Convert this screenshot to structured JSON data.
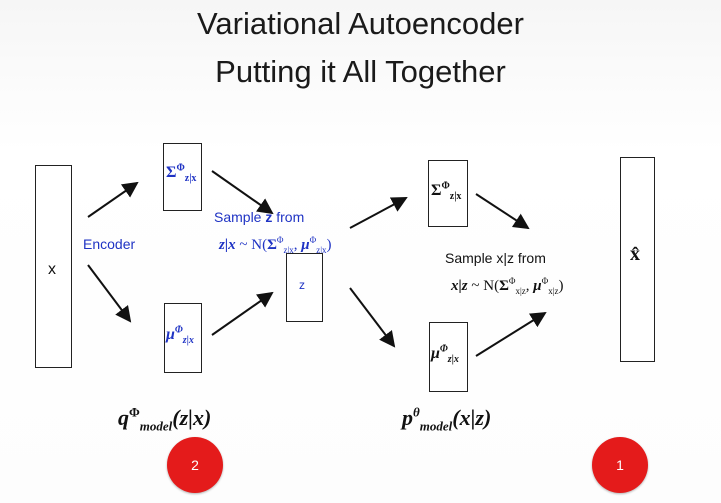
{
  "title": {
    "line1": "Variational Autoencoder",
    "line2": "Putting it All Together"
  },
  "labels": {
    "x": "x",
    "encoder": "Encoder",
    "z": "z",
    "sample_z_line1": "Sample z from",
    "sample_z_line2": "z|x ~ N(Σ, μ)",
    "sample_x_line1": "Sample x|z from",
    "sample_x_line2": "x|z ~ N(Σ, μ)",
    "x_hat": "x̂",
    "q_model": "q model (z|x)",
    "p_model": "p model (x|z)"
  },
  "buttons": {
    "left_circle": "2",
    "right_circle": "1"
  },
  "colors": {
    "blue_text": "#1f33c4",
    "circle_red": "#e41b1b"
  }
}
